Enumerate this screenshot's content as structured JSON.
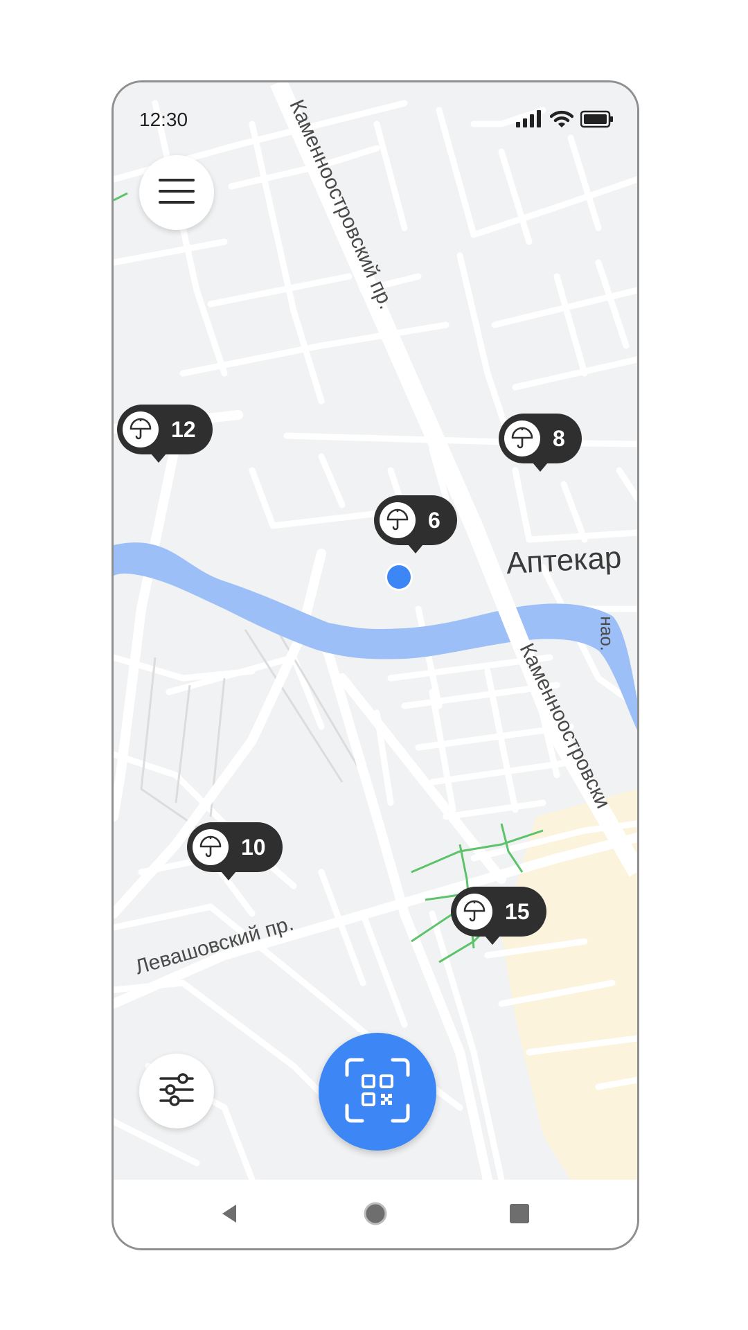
{
  "status_bar": {
    "time": "12:30",
    "icons": [
      "signal-icon",
      "wifi-icon",
      "battery-icon"
    ]
  },
  "map": {
    "street_labels": [
      "Каменноостровский пр.",
      "Каменноостровски",
      "Аптекар",
      "Левашовский пр.",
      "нао."
    ],
    "markers": [
      {
        "count": "12",
        "icon": "umbrella-icon"
      },
      {
        "count": "8",
        "icon": "umbrella-icon"
      },
      {
        "count": "6",
        "icon": "umbrella-icon"
      },
      {
        "count": "10",
        "icon": "umbrella-icon"
      },
      {
        "count": "15",
        "icon": "umbrella-icon"
      }
    ]
  },
  "controls": {
    "menu": "hamburger-icon",
    "filter": "sliders-icon",
    "scan": "qr-scan-icon"
  },
  "nav_bar": {
    "buttons": [
      "back-icon",
      "home-icon",
      "recents-icon"
    ]
  },
  "colors": {
    "accent": "#3d86f6",
    "marker": "#2f2f2f",
    "river": "#9dbff8",
    "map_bg": "#f1f2f3",
    "park": "#fbf3dc",
    "green_paths": "#5cc36a"
  }
}
